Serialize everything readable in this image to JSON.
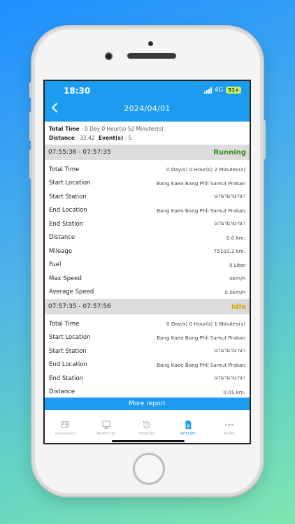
{
  "status_bar": {
    "time": "18:30",
    "network": "4G",
    "battery": "51+"
  },
  "header": {
    "title": "2024/04/01"
  },
  "summary": {
    "total_time_label": "Total Time",
    "total_time_value": ": 0 Day 0 Hour(s) 52 Minutes(s)",
    "distance_label": "Distance",
    "distance_value": ": 32.42",
    "events_label": "Event(s)",
    "events_value": ": 5"
  },
  "segments": [
    {
      "range": "07:55:36 - 07:57:35",
      "status": "Running",
      "rows": [
        {
          "label": "Total Time",
          "value": "0 Day(s) 0 Hour(s) 2 Minutes(s)"
        },
        {
          "label": "Start Location",
          "value": "Bang Kaeo Bang Phli Samut Prakan"
        },
        {
          "label": "Start Station",
          "value": "นานานานานา"
        },
        {
          "label": "End Location",
          "value": "Bang Kaeo Bang Phli Samut Prakan"
        },
        {
          "label": "End Station",
          "value": "นานานานานา"
        },
        {
          "label": "Distance",
          "value": "0.0 km."
        },
        {
          "label": "Mileage",
          "value": "75103.2 km."
        },
        {
          "label": "Fuel",
          "value": "0 Liter"
        },
        {
          "label": "Max Speed",
          "value": "0km/h"
        },
        {
          "label": "Average Speed",
          "value": "0.0km/h"
        }
      ]
    },
    {
      "range": "07:57:35 - 07:57:56",
      "status": "Idle",
      "rows": [
        {
          "label": "Total Time",
          "value": "0 Day(s) 0 Hour(s) 1 Minutes(s)"
        },
        {
          "label": "Start Location",
          "value": "Bang Kaeo Bang Phli Samut Prakan"
        },
        {
          "label": "Start Station",
          "value": "นานานานานา"
        },
        {
          "label": "End Location",
          "value": "Bang Kaeo Bang Phli Samut Prakan"
        },
        {
          "label": "End Station",
          "value": "นานานานานา"
        },
        {
          "label": "Distance",
          "value": "0.01 km."
        }
      ]
    }
  ],
  "more_report": "More report",
  "tabs": [
    {
      "label": "Dashboard",
      "icon": "dashboard-icon"
    },
    {
      "label": "MONITOR",
      "icon": "monitor-icon"
    },
    {
      "label": "HISTORY",
      "icon": "history-icon"
    },
    {
      "label": "REPORT",
      "icon": "report-icon",
      "active": true
    },
    {
      "label": "MORE",
      "icon": "more-icon"
    }
  ],
  "colors": {
    "accent": "#1d9bf0",
    "running": "#2f8f1a",
    "idle": "#d6a300"
  }
}
